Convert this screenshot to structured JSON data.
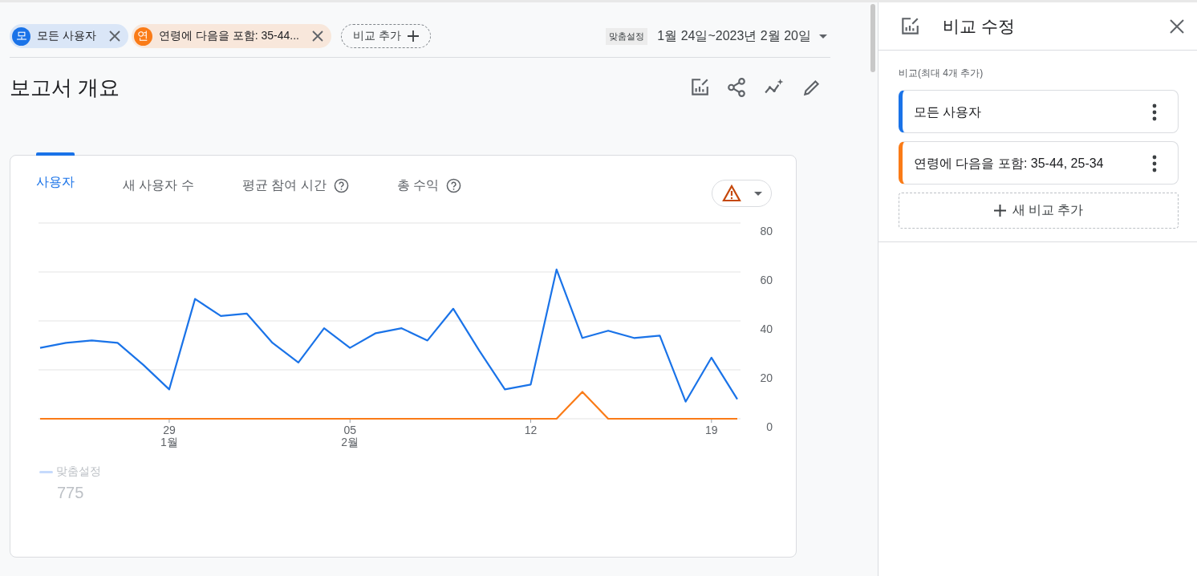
{
  "comparison_chips": [
    {
      "initial": "모",
      "label": "모든 사용자",
      "color": "#1a73e8"
    },
    {
      "initial": "연",
      "label": "연령에 다음을 포함: 35-44...",
      "color": "#fa7b17"
    }
  ],
  "add_comparison_button": "비교 추가",
  "date_range": {
    "preset": "맞춤설정",
    "range": "1월 24일~2023년 2월 20일"
  },
  "page_title": "보고서 개요",
  "card": {
    "tabs": [
      {
        "label": "사용자",
        "selected": true,
        "help": false
      },
      {
        "label": "새 사용자 수",
        "selected": false,
        "help": false
      },
      {
        "label": "평균 참여 시간",
        "selected": false,
        "help": true
      },
      {
        "label": "총 수익",
        "selected": false,
        "help": true
      }
    ],
    "chart_data": {
      "type": "line",
      "categories": [
        null,
        null,
        null,
        null,
        null,
        "29 1월",
        null,
        null,
        null,
        null,
        null,
        null,
        "05 2월",
        null,
        null,
        null,
        null,
        null,
        null,
        "12",
        null,
        null,
        null,
        null,
        null,
        null,
        "19",
        null
      ],
      "ylim": [
        0,
        80
      ],
      "grid": true,
      "yticks": [
        0,
        20,
        40,
        60,
        80
      ],
      "series": [
        {
          "color": "#1a73e8",
          "values": [
            29,
            31,
            32,
            31,
            22,
            12,
            49,
            42,
            43,
            31,
            23,
            37,
            29,
            35,
            37,
            32,
            45,
            28,
            12,
            14,
            61,
            33,
            36,
            33,
            34,
            7,
            25,
            8
          ]
        },
        {
          "color": "#fa7b17",
          "values": [
            0,
            0,
            0,
            0,
            0,
            0,
            0,
            0,
            0,
            0,
            0,
            0,
            0,
            0,
            0,
            0,
            0,
            0,
            0,
            0,
            0,
            11,
            0,
            0,
            0,
            0,
            0,
            0
          ]
        }
      ]
    },
    "legend": {
      "label": "맞춤설정",
      "value": "775"
    }
  },
  "panel": {
    "title": "비교 수정",
    "section_label": "비교(최대 4개 추가)",
    "comparisons": [
      {
        "label": "모든 사용자",
        "color": "#1a73e8"
      },
      {
        "label": "연령에 다음을 포함: 35-44, 25-34",
        "color": "#fa7b17"
      }
    ],
    "add_button": "새 비교 추가"
  }
}
